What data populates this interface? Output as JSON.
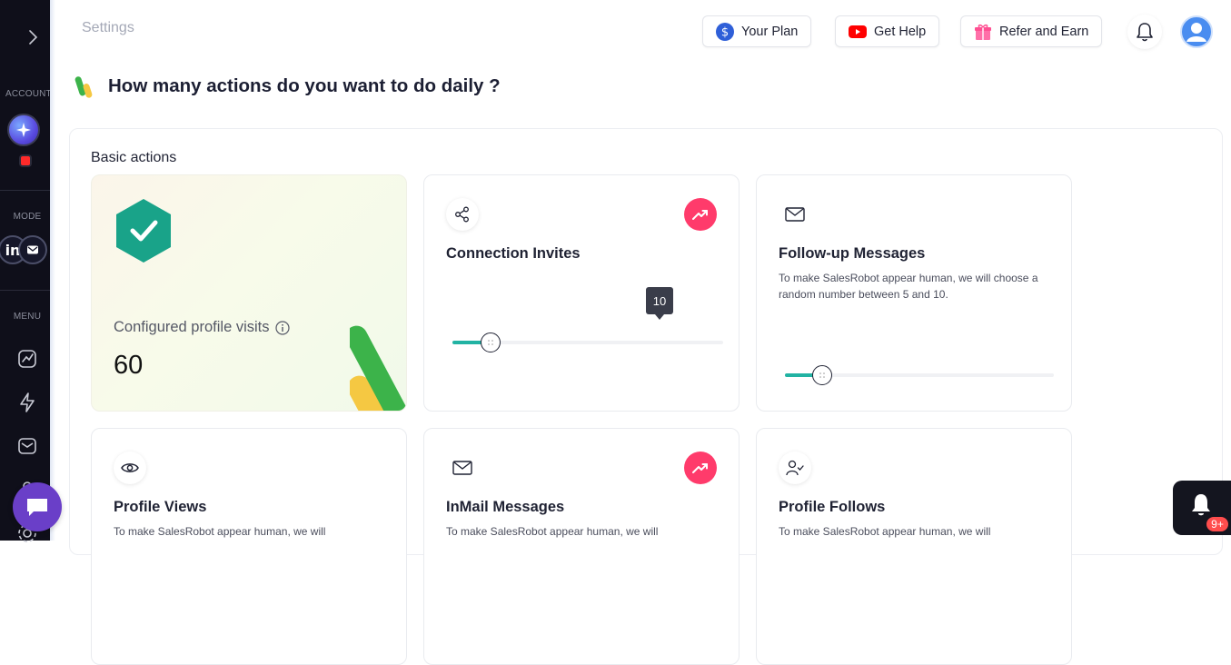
{
  "breadcrumb": "Settings",
  "header": {
    "your_plan": "Your Plan",
    "get_help": "Get Help",
    "refer_earn": "Refer and Earn"
  },
  "sidebar": {
    "account_label": "ACCOUNT",
    "mode_label": "MODE",
    "menu_label": "MENU",
    "menu_icons": [
      "analytics-icon",
      "bolt-icon",
      "inbox-icon",
      "users-icon",
      "settings-icon"
    ]
  },
  "page": {
    "question": "How many actions do you want to do daily ?",
    "section_title": "Basic actions"
  },
  "cards": {
    "profile_visits": {
      "label": "Configured profile visits",
      "value": "60"
    },
    "connection_invites": {
      "title": "Connection Invites",
      "slider_value": "10",
      "slider_fraction": 0.14
    },
    "followup_messages": {
      "title": "Follow-up Messages",
      "desc": "To make SalesRobot appear human, we will choose a random number between 5 and 10.",
      "slider_fraction": 0.14
    },
    "profile_views": {
      "title": "Profile Views",
      "desc": "To make SalesRobot appear human, we will"
    },
    "inmail_messages": {
      "title": "InMail Messages",
      "desc": "To make SalesRobot appear human, we will"
    },
    "profile_follows": {
      "title": "Profile Follows",
      "desc": "To make SalesRobot appear human, we will"
    }
  },
  "notifications": {
    "badge": "9+"
  },
  "colors": {
    "accent_teal": "#22b3a3",
    "trend_red": "#ff3b6b",
    "sidebar_bg": "#0f0f1a",
    "chat_purple": "#6a3fc8"
  }
}
